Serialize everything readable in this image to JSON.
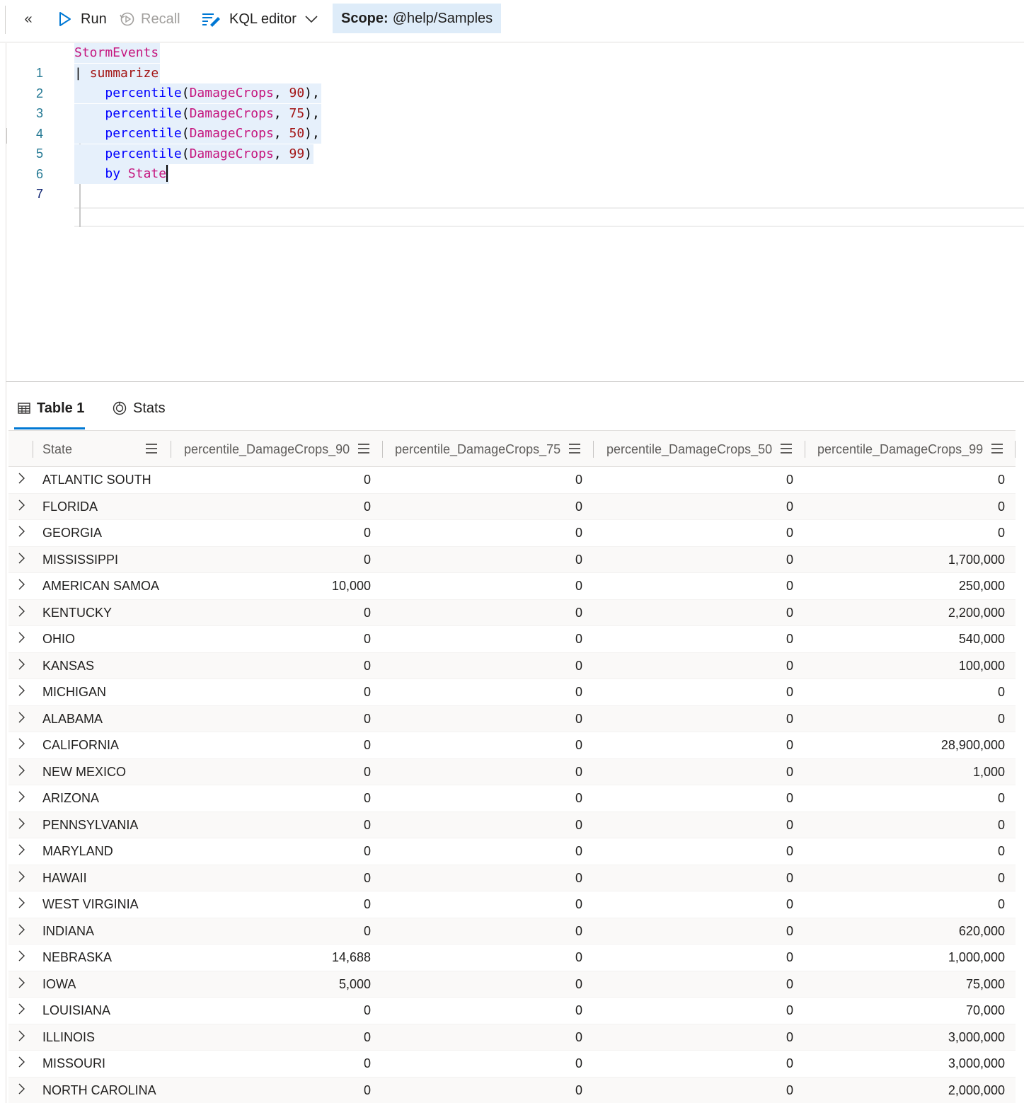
{
  "toolbar": {
    "run_label": "Run",
    "recall_label": "Recall",
    "editor_mode_label": "KQL editor",
    "scope_prefix": "Scope:",
    "scope_value": "@help/Samples"
  },
  "editor": {
    "line_numbers": [
      "1",
      "2",
      "3",
      "4",
      "5",
      "6",
      "7"
    ],
    "lines": {
      "l1_table": "StormEvents",
      "l2_pipe": "| ",
      "l2_op": "summarize",
      "l3_fn": "percentile",
      "l3_col": "DamageCrops",
      "l3_num": "90",
      "l4_fn": "percentile",
      "l4_col": "DamageCrops",
      "l4_num": "75",
      "l5_fn": "percentile",
      "l5_col": "DamageCrops",
      "l5_num": "50",
      "l6_fn": "percentile",
      "l6_col": "DamageCrops",
      "l6_num": "99",
      "l7_kw": "by",
      "l7_col": "State"
    }
  },
  "results": {
    "tabs": {
      "table_label": "Table 1",
      "stats_label": "Stats"
    },
    "columns": [
      "State",
      "percentile_DamageCrops_90",
      "percentile_DamageCrops_75",
      "percentile_DamageCrops_50",
      "percentile_DamageCrops_99"
    ],
    "rows": [
      [
        "ATLANTIC SOUTH",
        "0",
        "0",
        "0",
        "0"
      ],
      [
        "FLORIDA",
        "0",
        "0",
        "0",
        "0"
      ],
      [
        "GEORGIA",
        "0",
        "0",
        "0",
        "0"
      ],
      [
        "MISSISSIPPI",
        "0",
        "0",
        "0",
        "1,700,000"
      ],
      [
        "AMERICAN SAMOA",
        "10,000",
        "0",
        "0",
        "250,000"
      ],
      [
        "KENTUCKY",
        "0",
        "0",
        "0",
        "2,200,000"
      ],
      [
        "OHIO",
        "0",
        "0",
        "0",
        "540,000"
      ],
      [
        "KANSAS",
        "0",
        "0",
        "0",
        "100,000"
      ],
      [
        "MICHIGAN",
        "0",
        "0",
        "0",
        "0"
      ],
      [
        "ALABAMA",
        "0",
        "0",
        "0",
        "0"
      ],
      [
        "CALIFORNIA",
        "0",
        "0",
        "0",
        "28,900,000"
      ],
      [
        "NEW MEXICO",
        "0",
        "0",
        "0",
        "1,000"
      ],
      [
        "ARIZONA",
        "0",
        "0",
        "0",
        "0"
      ],
      [
        "PENNSYLVANIA",
        "0",
        "0",
        "0",
        "0"
      ],
      [
        "MARYLAND",
        "0",
        "0",
        "0",
        "0"
      ],
      [
        "HAWAII",
        "0",
        "0",
        "0",
        "0"
      ],
      [
        "WEST VIRGINIA",
        "0",
        "0",
        "0",
        "0"
      ],
      [
        "INDIANA",
        "0",
        "0",
        "0",
        "620,000"
      ],
      [
        "NEBRASKA",
        "14,688",
        "0",
        "0",
        "1,000,000"
      ],
      [
        "IOWA",
        "5,000",
        "0",
        "0",
        "75,000"
      ],
      [
        "LOUISIANA",
        "0",
        "0",
        "0",
        "70,000"
      ],
      [
        "ILLINOIS",
        "0",
        "0",
        "0",
        "3,000,000"
      ],
      [
        "MISSOURI",
        "0",
        "0",
        "0",
        "3,000,000"
      ],
      [
        "NORTH CAROLINA",
        "0",
        "0",
        "0",
        "2,000,000"
      ]
    ]
  },
  "colors": {
    "accent": "#0078d4",
    "scope_bg": "#deecf9",
    "line_number": "#237893",
    "kql_table": "#c5167e",
    "kql_function": "#0000ff",
    "kql_number": "#a31515"
  }
}
